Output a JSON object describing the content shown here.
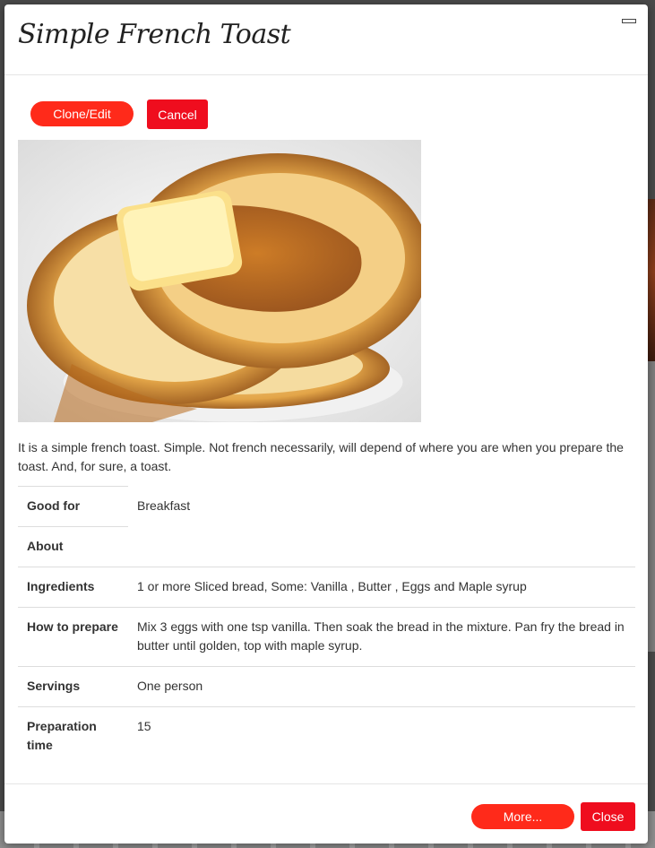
{
  "modal": {
    "title": "Simple French Toast",
    "minimize_icon": "window-minimize-icon"
  },
  "actions": {
    "clone_edit_label": "Clone/Edit",
    "cancel_label": "Cancel"
  },
  "recipe": {
    "image_alt": "French toast with butter and maple syrup",
    "description": "It is a simple french toast. Simple. Not french necessarily, will depend of where you are when you prepare the toast. And, for sure, a toast.",
    "details": [
      {
        "label": "Good for",
        "value": "Breakfast"
      },
      {
        "label": "About",
        "value": ""
      },
      {
        "label": "Ingredients",
        "value": "1 or more Sliced bread, Some: Vanilla , Butter , Eggs and Maple syrup"
      },
      {
        "label": "How to prepare",
        "value": "Mix 3 eggs with one tsp vanilla. Then soak the bread in the mixture. Pan fry the bread in butter until golden, top with maple syrup."
      },
      {
        "label": "Servings",
        "value": "One person"
      },
      {
        "label": "Preparation time",
        "value": "15"
      }
    ]
  },
  "footer": {
    "more_label": "More...",
    "close_label": "Close"
  },
  "colors": {
    "accent_pill": "#ff2a1a",
    "accent_red": "#ef0d1e"
  }
}
